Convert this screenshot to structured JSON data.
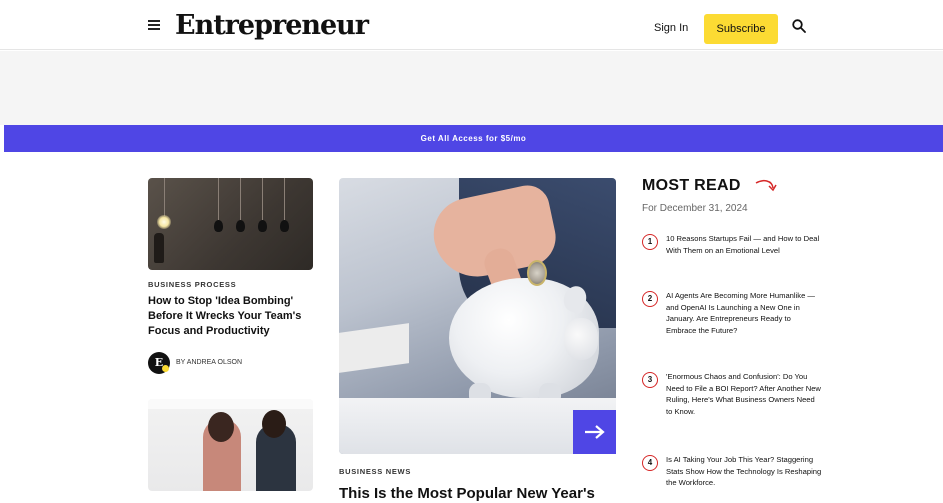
{
  "header": {
    "logo": "Entrepreneur",
    "sign_in": "Sign In",
    "subscribe": "Subscribe"
  },
  "promo_bar": {
    "text": "Get All Access for $5/mo"
  },
  "left_column": {
    "article1": {
      "category": "BUSINESS PROCESS",
      "title": "How to Stop 'Idea Bombing' Before It Wrecks Your Team's Focus and Productivity",
      "author": "BY ANDREA OLSON",
      "avatar_letter": "E"
    }
  },
  "feature": {
    "category": "BUSINESS NEWS",
    "title": "This Is the Most Popular New Year's"
  },
  "most_read": {
    "heading": "MOST READ",
    "date": "For December 31, 2024",
    "items": [
      {
        "num": "1",
        "text": "10 Reasons Startups Fail — and How to Deal With Them on an Emotional Level"
      },
      {
        "num": "2",
        "text": "AI Agents Are Becoming More Humanlike — and OpenAI Is Launching a New One in January. Are Entrepreneurs Ready to Embrace the Future?"
      },
      {
        "num": "3",
        "text": "'Enormous Chaos and Confusion': Do You Need to File a BOI Report? After Another New Ruling, Here's What Business Owners Need to Know."
      },
      {
        "num": "4",
        "text": "Is AI Taking Your Job This Year? Staggering Stats Show How the Technology Is Reshaping the Workforce."
      }
    ]
  },
  "colors": {
    "accent": "#4f46e5",
    "subscribe": "#fcdb33",
    "rank_ring": "#d62828"
  }
}
